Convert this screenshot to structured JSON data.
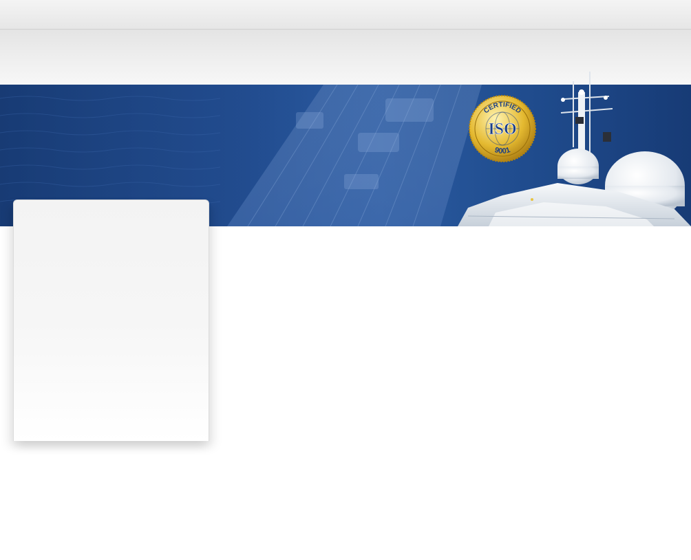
{
  "header": {
    "topbar": {},
    "navigation": {}
  },
  "banner": {
    "theme_colors": {
      "sea": "#1f4a8c",
      "deck": "#3a66a8",
      "ship_white": "#f2f4f7",
      "seal_gold": "#e0b62e",
      "seal_blue": "#1c3f86"
    },
    "seal": {
      "top_text": "CERTIFIED",
      "center_text": "ISO",
      "bottom_text": "9001"
    }
  },
  "sidebar": {},
  "main": {}
}
